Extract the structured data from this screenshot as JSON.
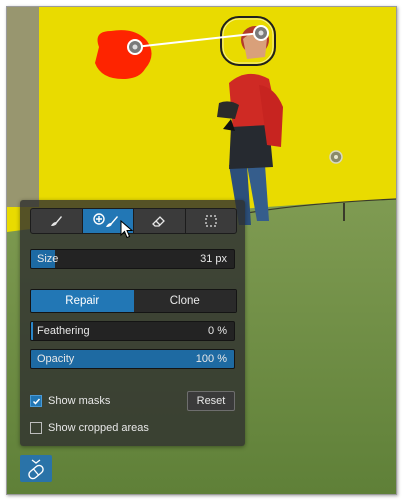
{
  "toolbar": {
    "tools": [
      {
        "name": "brush-tool",
        "icon": "brush-icon",
        "active": false
      },
      {
        "name": "heal-clone-tool",
        "icon": "heal-brush-icon",
        "active": true
      },
      {
        "name": "eraser-tool",
        "icon": "eraser-icon",
        "active": false
      },
      {
        "name": "crop-tool",
        "icon": "crop-icon",
        "active": false
      }
    ]
  },
  "size": {
    "label": "Size",
    "value": "31 px",
    "fill_fraction": 0.12
  },
  "mode": {
    "options": [
      "Repair",
      "Clone"
    ],
    "selected": "Repair"
  },
  "feathering": {
    "label": "Feathering",
    "value": "0 %"
  },
  "opacity": {
    "label": "Opacity",
    "value": "100 %"
  },
  "show_masks": {
    "label": "Show masks",
    "checked": true
  },
  "reset": {
    "label": "Reset"
  },
  "show_cropped": {
    "label": "Show cropped areas",
    "checked": false
  },
  "colors": {
    "accent": "#2277b5",
    "panel_bg": "#303030",
    "mask_red": "#ff1a00",
    "field_yellow": "#f2e400",
    "grass_green": "#6c8d46"
  }
}
